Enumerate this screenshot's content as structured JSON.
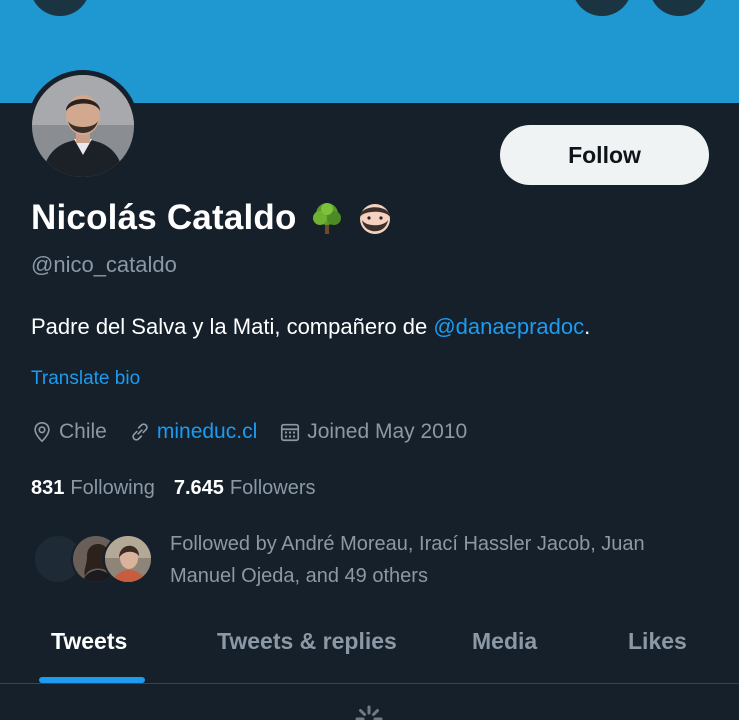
{
  "header": {
    "back_icon": "arrow-left-icon",
    "search_icon": "search-icon",
    "more_icon": "more-icon",
    "banner_color": "#1f97d0"
  },
  "profile": {
    "name": "Nicolás Cataldo",
    "name_emojis": [
      "tree-emoji-icon",
      "bearded-man-emoji-icon"
    ],
    "handle": "@nico_cataldo",
    "bio_text": "Padre del Salva y la Mati, compañero de ",
    "bio_mention": "@danaepradoc",
    "bio_end": ".",
    "translate_label": "Translate bio",
    "location": "Chile",
    "website": "mineduc.cl",
    "joined": "Joined May 2010",
    "follow_label": "Follow"
  },
  "stats": {
    "following_count": "831",
    "following_label": "Following",
    "followers_count": "7.645",
    "followers_label": "Followers"
  },
  "followed_by": {
    "text": "Followed by André Moreau, Irací Hassler Jacob, Juan Manuel Ojeda, and 49 others"
  },
  "tabs": [
    {
      "label": "Tweets",
      "active": true
    },
    {
      "label": "Tweets & replies",
      "active": false
    },
    {
      "label": "Media",
      "active": false
    },
    {
      "label": "Likes",
      "active": false
    }
  ],
  "colors": {
    "background": "#15202b",
    "accent": "#1d9bf0",
    "muted_text": "#8b98a5"
  }
}
